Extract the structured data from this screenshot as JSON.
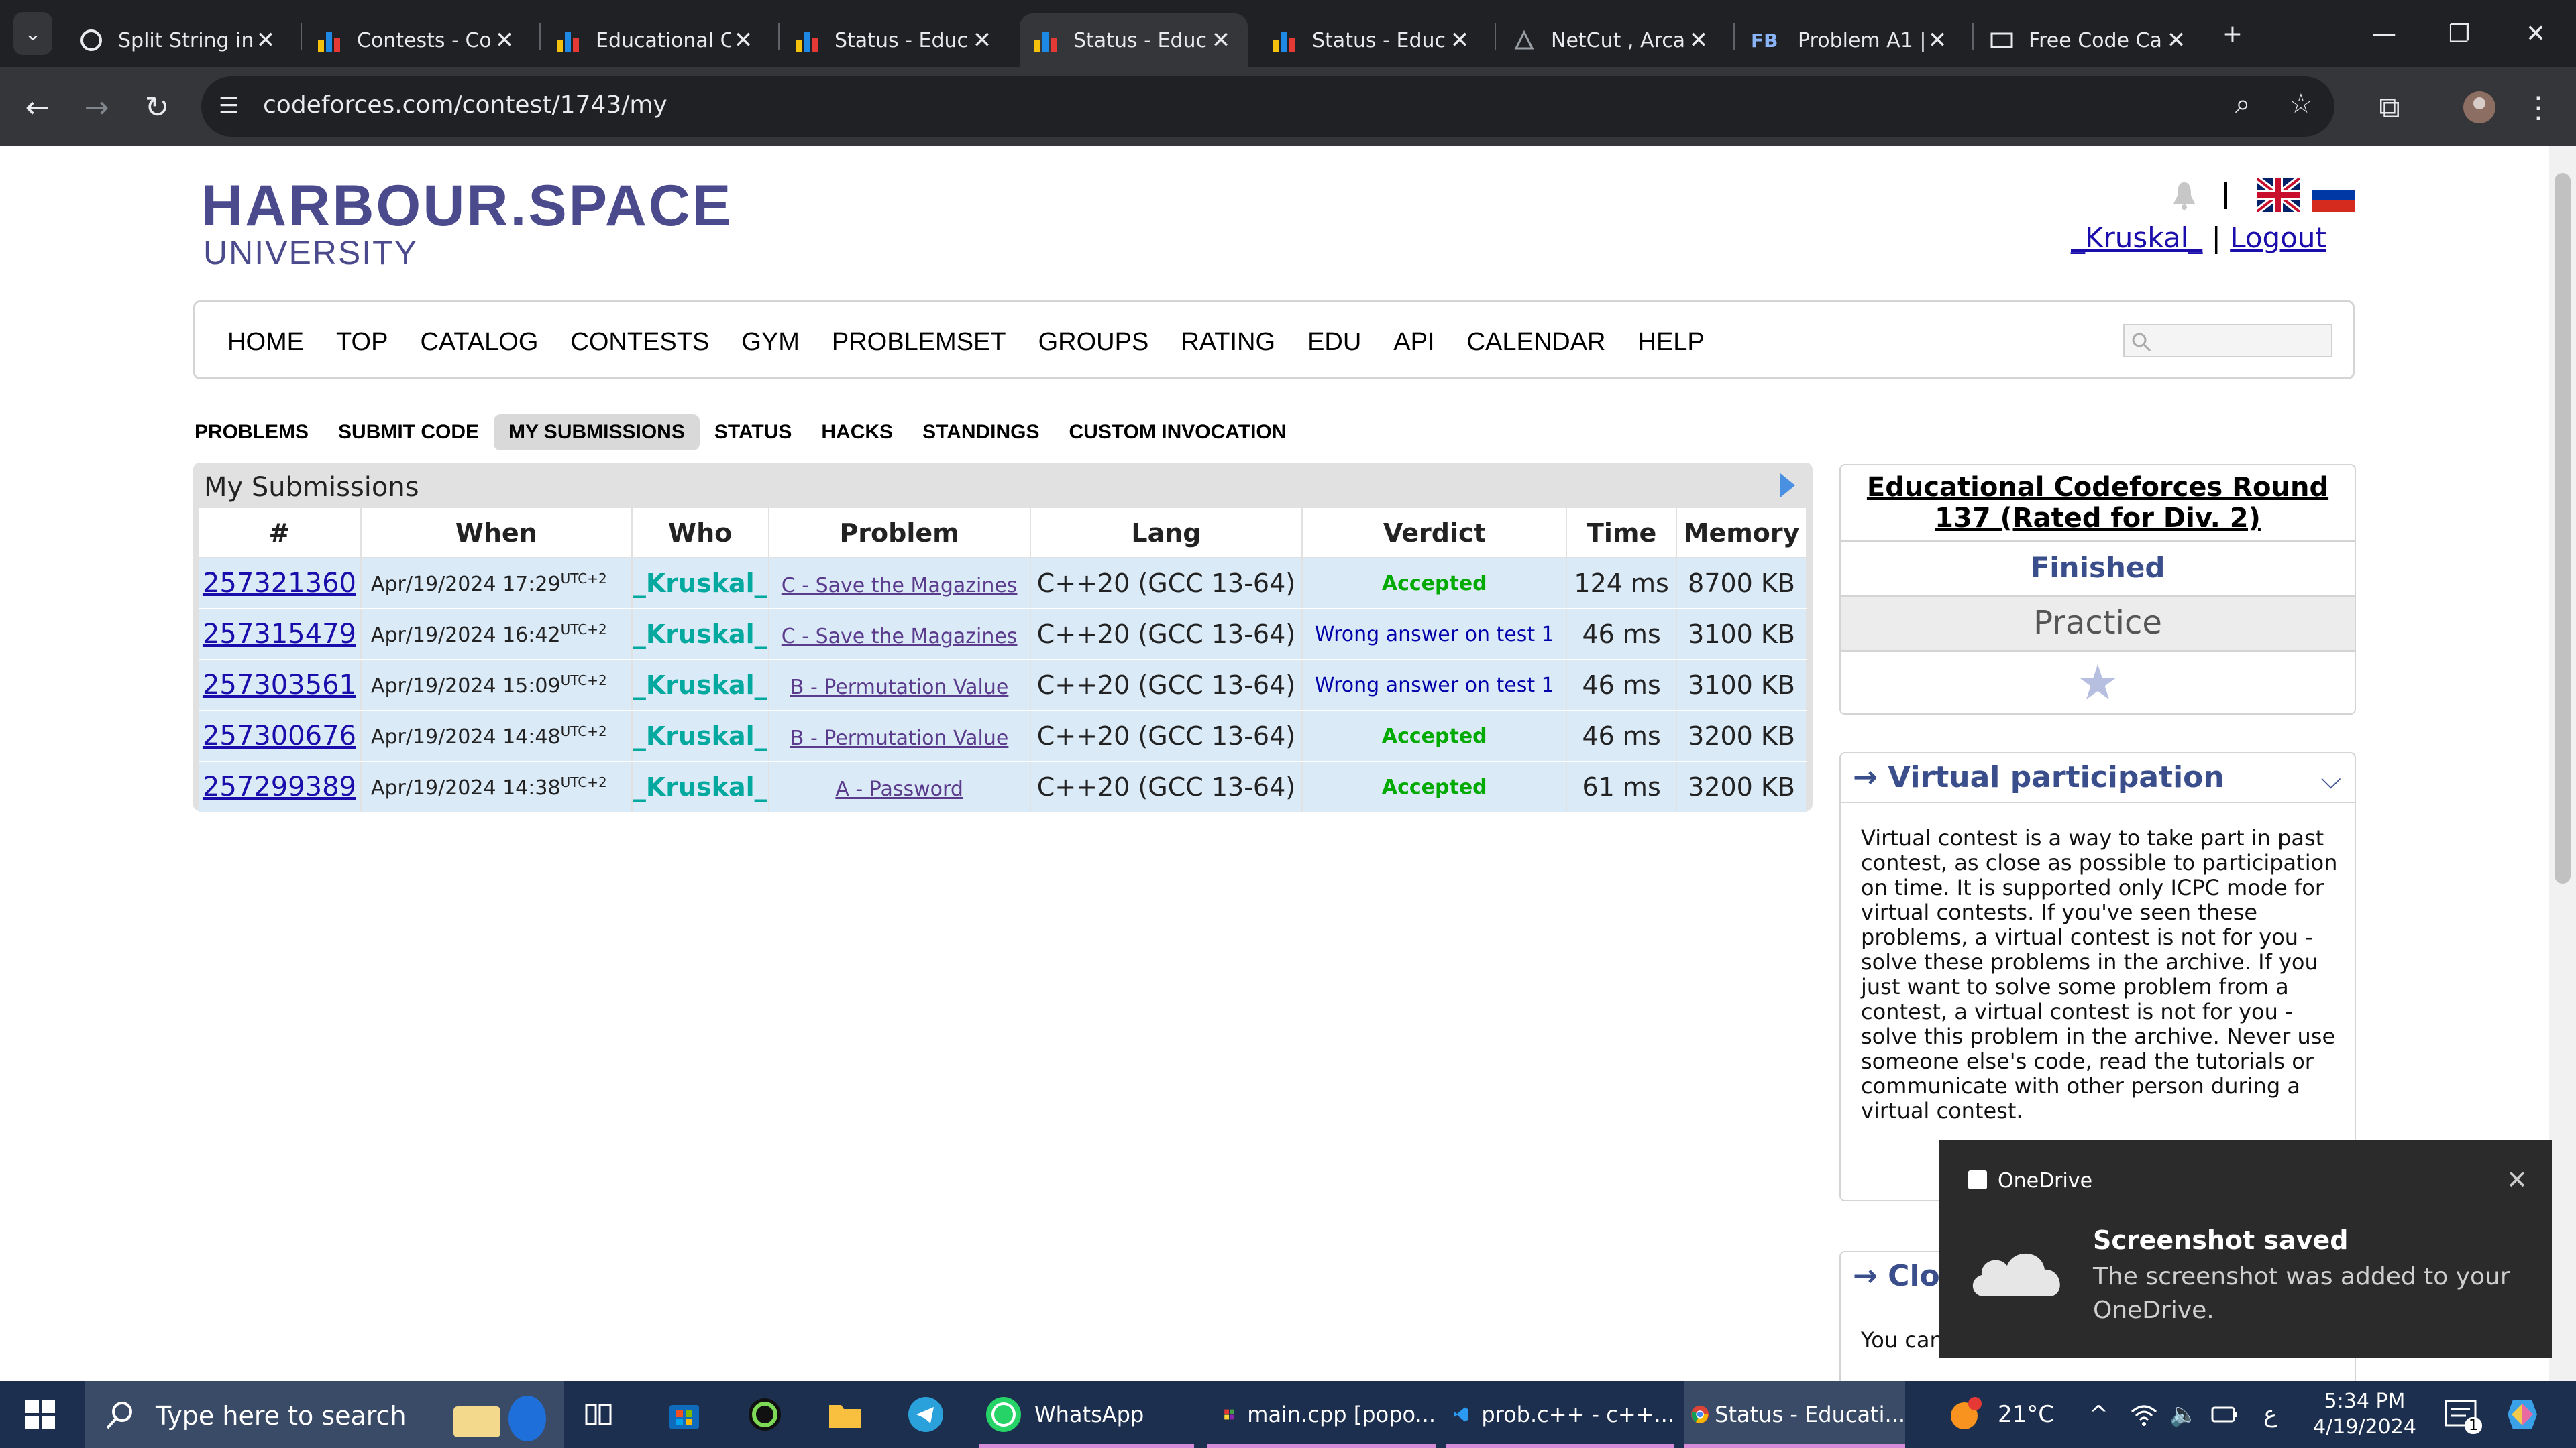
{
  "tabs": [
    {
      "title": "Split String in",
      "icon": "chatgpt-icon"
    },
    {
      "title": "Contests - Co",
      "icon": "codeforces-icon"
    },
    {
      "title": "Educational C",
      "icon": "codeforces-icon"
    },
    {
      "title": "Status - Educ",
      "icon": "codeforces-icon"
    },
    {
      "title": "Status - Educ",
      "icon": "codeforces-icon"
    },
    {
      "title": "Status - Educ",
      "icon": "codeforces-icon"
    },
    {
      "title": "NetCut , Arca",
      "icon": "netcut-icon"
    },
    {
      "title": "Problem A1 |",
      "icon": "facebook-icon"
    },
    {
      "title": "Free Code Ca",
      "icon": "freecodecamp-icon"
    }
  ],
  "browser": {
    "url": "codeforces.com/contest/1743/my"
  },
  "logo": {
    "line1": "HARBOUR.SPACE",
    "line2": "UNIVERSITY"
  },
  "user": {
    "handle": "_Kruskal_",
    "sep": "|",
    "logout": "Logout"
  },
  "main_menu": [
    "HOME",
    "TOP",
    "CATALOG",
    "CONTESTS",
    "GYM",
    "PROBLEMSET",
    "GROUPS",
    "RATING",
    "EDU",
    "API",
    "CALENDAR",
    "HELP"
  ],
  "second_menu": [
    "PROBLEMS",
    "SUBMIT CODE",
    "MY SUBMISSIONS",
    "STATUS",
    "HACKS",
    "STANDINGS",
    "CUSTOM INVOCATION"
  ],
  "submissions": {
    "title": "My Submissions",
    "headers": [
      "#",
      "When",
      "Who",
      "Problem",
      "Lang",
      "Verdict",
      "Time",
      "Memory"
    ],
    "rows": [
      {
        "id": "257321360",
        "when": "Apr/19/2024 17:29",
        "tz": "UTC+2",
        "who": "_Kruskal_",
        "problem": "C - Save the Magazines",
        "lang": "C++20 (GCC 13-64)",
        "verdict": "Accepted",
        "time": "124 ms",
        "memory": "8700 KB"
      },
      {
        "id": "257315479",
        "when": "Apr/19/2024 16:42",
        "tz": "UTC+2",
        "who": "_Kruskal_",
        "problem": "C - Save the Magazines",
        "lang": "C++20 (GCC 13-64)",
        "verdict": "Wrong answer on test 1",
        "time": "46 ms",
        "memory": "3100 KB"
      },
      {
        "id": "257303561",
        "when": "Apr/19/2024 15:09",
        "tz": "UTC+2",
        "who": "_Kruskal_",
        "problem": "B - Permutation Value",
        "lang": "C++20 (GCC 13-64)",
        "verdict": "Wrong answer on test 1",
        "time": "46 ms",
        "memory": "3100 KB"
      },
      {
        "id": "257300676",
        "when": "Apr/19/2024 14:48",
        "tz": "UTC+2",
        "who": "_Kruskal_",
        "problem": "B - Permutation Value",
        "lang": "C++20 (GCC 13-64)",
        "verdict": "Accepted",
        "time": "46 ms",
        "memory": "3200 KB"
      },
      {
        "id": "257299389",
        "when": "Apr/19/2024 14:38",
        "tz": "UTC+2",
        "who": "_Kruskal_",
        "problem": "A - Password",
        "lang": "C++20 (GCC 13-64)",
        "verdict": "Accepted",
        "time": "61 ms",
        "memory": "3200 KB"
      }
    ]
  },
  "sidebar": {
    "contest_name": "Educational Codeforces Round 137 (Rated for Div. 2)",
    "status": "Finished",
    "practice": "Practice",
    "virtual_title": "→ Virtual participation",
    "virtual_text": "Virtual contest is a way to take part in past contest, as close as possible to participation on time. It is supported only ICPC mode for virtual contests. If you've seen these problems, a virtual contest is not for you - solve these problems in the archive. If you just want to solve some problem from a contest, a virtual contest is not for you - solve this problem in the archive. Never use someone else's code, read the tutorials or communicate with other person during a virtual contest.",
    "clo_title": "→ Clo",
    "clo_text": "You can"
  },
  "toast": {
    "app": "OneDrive",
    "title": "Screenshot saved",
    "body": "The screenshot was added to your OneDrive."
  },
  "taskbar": {
    "search_placeholder": "Type here to search",
    "apps": [
      "WhatsApp",
      "main.cpp [popo...",
      "prob.c++ - c++...",
      "Status - Educati..."
    ],
    "weather": "21°C",
    "lang": "ع",
    "time": "5:34 PM",
    "date": "4/19/2024",
    "notif_count": "1"
  },
  "colors": {
    "accent": "#3a4e8c",
    "accepted": "#00aa00",
    "wrong": "#0000aa",
    "handle": "#03a89e",
    "row_bg": "#dbeaf7"
  }
}
